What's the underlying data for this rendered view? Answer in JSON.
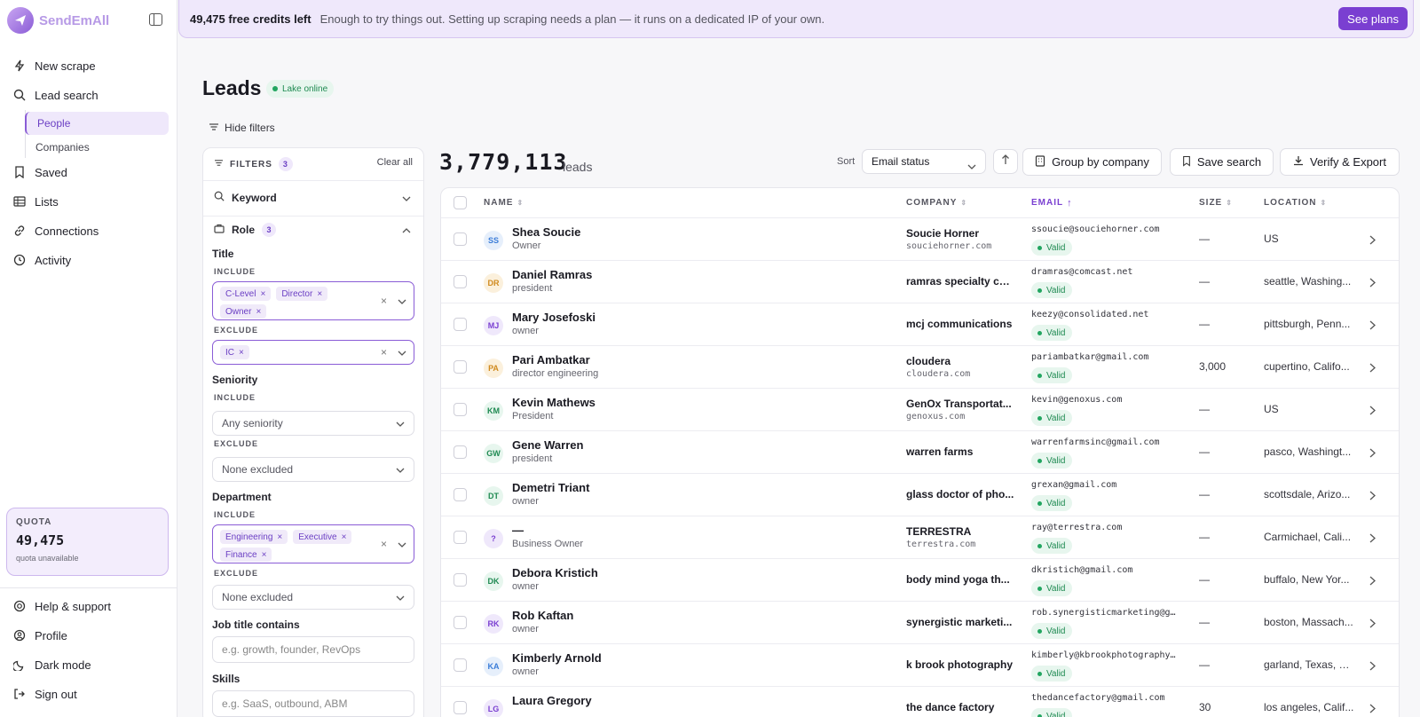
{
  "sidebar": {
    "brand": "SendEmAll",
    "nav": [
      {
        "label": "New scrape",
        "icon": "bolt-icon"
      },
      {
        "label": "Lead search",
        "icon": "search-icon"
      },
      {
        "label": "Saved",
        "icon": "bookmark-icon"
      },
      {
        "label": "Lists",
        "icon": "list-icon"
      },
      {
        "label": "Connections",
        "icon": "link-icon"
      },
      {
        "label": "Activity",
        "icon": "clock-icon"
      }
    ],
    "subnav": [
      {
        "label": "People",
        "active": true
      },
      {
        "label": "Companies",
        "active": false
      }
    ],
    "quota": {
      "label": "QUOTA",
      "value": "49,475",
      "sub": "quota unavailable"
    },
    "bottom": [
      {
        "label": "Help & support",
        "icon": "help-icon"
      },
      {
        "label": "Profile",
        "icon": "user-icon"
      },
      {
        "label": "Dark mode",
        "icon": "moon-icon"
      },
      {
        "label": "Sign out",
        "icon": "sign-out-icon"
      }
    ]
  },
  "banner": {
    "credits": "49,475 free credits left",
    "message": "Enough to try things out. Setting up scraping needs a plan — it runs on a dedicated IP of your own.",
    "cta": "See plans"
  },
  "page": {
    "title": "Leads",
    "status": "Lake online",
    "hide_filters": "Hide filters"
  },
  "filters": {
    "title": "FILTERS",
    "count": "3",
    "clear_all": "Clear all",
    "keyword": "Keyword",
    "role": {
      "label": "Role",
      "count": "3"
    },
    "title_section": {
      "label": "Title",
      "include_label": "INCLUDE",
      "include": [
        "C-Level",
        "Director",
        "Owner"
      ],
      "exclude_label": "EXCLUDE",
      "exclude": [
        "IC"
      ]
    },
    "seniority": {
      "label": "Seniority",
      "include_label": "INCLUDE",
      "include_value": "Any seniority",
      "exclude_label": "EXCLUDE",
      "exclude_value": "None excluded"
    },
    "department": {
      "label": "Department",
      "include_label": "INCLUDE",
      "include": [
        "Engineering",
        "Executive",
        "Finance"
      ],
      "exclude_label": "EXCLUDE",
      "exclude_value": "None excluded"
    },
    "job_title": {
      "label": "Job title contains",
      "placeholder": "e.g. growth, founder, RevOps"
    },
    "skills": {
      "label": "Skills",
      "placeholder": "e.g. SaaS, outbound, ABM"
    }
  },
  "results": {
    "count": "3,779,113",
    "count_label": "leads",
    "sort_label": "Sort",
    "sort_value": "Email status",
    "group_by": "Group by company",
    "save_search": "Save search",
    "verify_export": "Verify & Export"
  },
  "table": {
    "columns": [
      "NAME",
      "COMPANY",
      "EMAIL",
      "SIZE",
      "LOCATION"
    ],
    "valid_label": "Valid",
    "rows": [
      {
        "initials": "SS",
        "name": "Shea Soucie",
        "role": "Owner",
        "company": "Soucie Horner",
        "domain": "souciehorner.com",
        "email": "ssoucie@souciehorner.com",
        "size": "—",
        "location": "US",
        "color": "#3b7dd8",
        "bg": "#e6effb"
      },
      {
        "initials": "DR",
        "name": "Daniel Ramras",
        "role": "president",
        "company": "ramras specialty co...",
        "domain": "",
        "email": "dramras@comcast.net",
        "size": "—",
        "location": "seattle, Washing...",
        "color": "#d08a1e",
        "bg": "#fbf0dc"
      },
      {
        "initials": "MJ",
        "name": "Mary Josefoski",
        "role": "owner",
        "company": "mcj communications",
        "domain": "",
        "email": "keezy@consolidated.net",
        "size": "—",
        "location": "pittsburgh, Penn...",
        "color": "#7a3fd1",
        "bg": "#efe8fb"
      },
      {
        "initials": "PA",
        "name": "Pari Ambatkar",
        "role": "director engineering",
        "company": "cloudera",
        "domain": "cloudera.com",
        "email": "pariambatkar@gmail.com",
        "size": "3,000",
        "location": "cupertino, Califo...",
        "color": "#d08a1e",
        "bg": "#fbf0dc"
      },
      {
        "initials": "KM",
        "name": "Kevin Mathews",
        "role": "President",
        "company": "GenOx Transportat...",
        "domain": "genoxus.com",
        "email": "kevin@genoxus.com",
        "size": "—",
        "location": "US",
        "color": "#1f8a52",
        "bg": "#e7f6ee"
      },
      {
        "initials": "GW",
        "name": "Gene Warren",
        "role": "president",
        "company": "warren farms",
        "domain": "",
        "email": "warrenfarmsinc@gmail.com",
        "size": "—",
        "location": "pasco, Washingt...",
        "color": "#1f8a52",
        "bg": "#e7f6ee"
      },
      {
        "initials": "DT",
        "name": "Demetri Triant",
        "role": "owner",
        "company": "glass doctor of pho...",
        "domain": "",
        "email": "grexan@gmail.com",
        "size": "—",
        "location": "scottsdale, Arizo...",
        "color": "#1f8a52",
        "bg": "#e7f6ee"
      },
      {
        "initials": "?",
        "name": "—",
        "role": "Business Owner",
        "company": "TERRESTRA",
        "domain": "terrestra.com",
        "email": "ray@terrestra.com",
        "size": "—",
        "location": "Carmichael, Cali...",
        "color": "#7a3fd1",
        "bg": "#efe8fb"
      },
      {
        "initials": "DK",
        "name": "Debora Kristich",
        "role": "owner",
        "company": "body mind yoga th...",
        "domain": "",
        "email": "dkristich@gmail.com",
        "size": "—",
        "location": "buffalo, New Yor...",
        "color": "#1f8a52",
        "bg": "#e7f6ee"
      },
      {
        "initials": "RK",
        "name": "Rob Kaftan",
        "role": "owner",
        "company": "synergistic marketi...",
        "domain": "",
        "email": "rob.synergisticmarketing@g...",
        "size": "—",
        "location": "boston, Massach...",
        "color": "#7a3fd1",
        "bg": "#efe8fb"
      },
      {
        "initials": "KA",
        "name": "Kimberly Arnold",
        "role": "owner",
        "company": "k brook photography",
        "domain": "",
        "email": "kimberly@kbrookphotography...",
        "size": "—",
        "location": "garland, Texas, U...",
        "color": "#3b7dd8",
        "bg": "#e6effb"
      },
      {
        "initials": "LG",
        "name": "Laura Gregory",
        "role": "",
        "company": "the dance factory",
        "domain": "",
        "email": "thedancefactory@gmail.com",
        "size": "30",
        "location": "los angeles, Calif...",
        "color": "#7a3fd1",
        "bg": "#efe8fb"
      }
    ]
  }
}
